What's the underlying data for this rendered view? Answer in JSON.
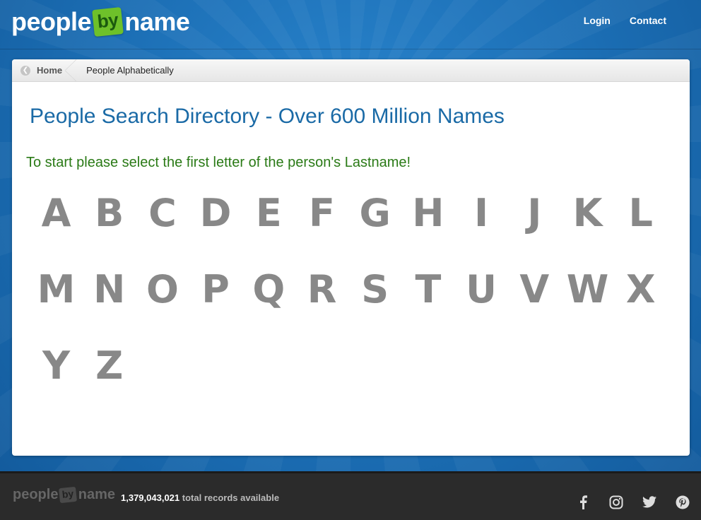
{
  "header": {
    "logo": {
      "part1": "people",
      "part2": "by",
      "part3": "name"
    },
    "nav": [
      {
        "label": "Login"
      },
      {
        "label": "Contact"
      }
    ]
  },
  "breadcrumb": {
    "home": "Home",
    "current": "People Alphabetically"
  },
  "main": {
    "title": "People Search Directory - Over 600 Million Names",
    "instruction": "To start please select the first letter of the person's Lastname!",
    "letters": [
      "A",
      "B",
      "C",
      "D",
      "E",
      "F",
      "G",
      "H",
      "I",
      "J",
      "K",
      "L",
      "M",
      "N",
      "O",
      "P",
      "Q",
      "R",
      "S",
      "T",
      "U",
      "V",
      "W",
      "X",
      "Y",
      "Z"
    ]
  },
  "footer": {
    "logo": {
      "part1": "people",
      "part2": "by",
      "part3": "name"
    },
    "records_count": "1,379,043,021",
    "records_text": "total records available",
    "social": [
      "facebook-icon",
      "instagram-icon",
      "twitter-icon",
      "pinterest-icon"
    ]
  },
  "colors": {
    "background_blue": "#1b6db3",
    "title_blue": "#1a6aa6",
    "instruction_green": "#2a7a16",
    "letter_gray": "#888888",
    "footer_dark": "#2b2b2b",
    "logo_green": "#6ec12a"
  }
}
